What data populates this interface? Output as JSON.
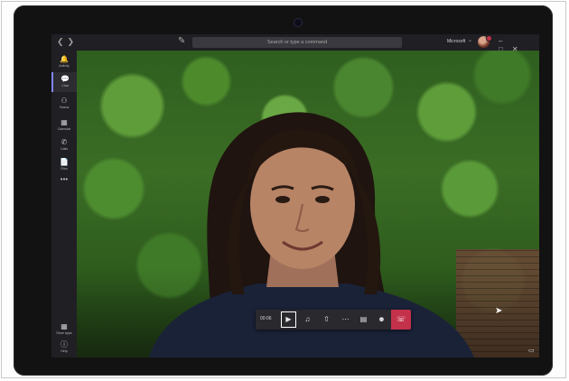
{
  "titlebar": {
    "back_icon": "chevron-left-icon",
    "forward_icon": "chevron-right-icon",
    "search_placeholder": "Search or type a command",
    "org_name": "Microsoft",
    "org_chevron": "chevron-down-icon"
  },
  "rail": {
    "items": [
      {
        "label": "Activity",
        "icon": "bell-icon",
        "active": false
      },
      {
        "label": "Chat",
        "icon": "chat-icon",
        "active": true
      },
      {
        "label": "Teams",
        "icon": "teams-icon",
        "active": false
      },
      {
        "label": "Calendar",
        "icon": "calendar-icon",
        "active": false
      },
      {
        "label": "Calls",
        "icon": "phone-icon",
        "active": false
      },
      {
        "label": "Files",
        "icon": "file-icon",
        "active": false
      }
    ],
    "more_label": "•••",
    "bottom": [
      {
        "label": "Store apps",
        "icon": "apps-icon"
      },
      {
        "label": "Help",
        "icon": "help-icon"
      }
    ]
  },
  "call": {
    "timer": "00:06",
    "controls": [
      "camera",
      "microphone",
      "share",
      "more",
      "chat",
      "participants"
    ],
    "colors": {
      "hangup": "#c4314b",
      "bar": "#2a292e",
      "accent": "#7f85f5"
    }
  }
}
